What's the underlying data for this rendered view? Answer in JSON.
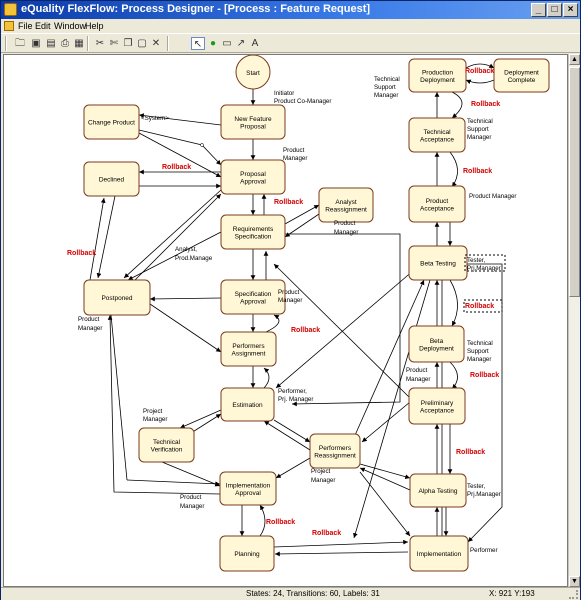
{
  "window": {
    "title": "eQuality FlexFlow: Process Designer - [Process : Feature Request]",
    "controls": [
      "_",
      "□",
      "×"
    ]
  },
  "menu": [
    "File",
    "Edit",
    "Window",
    "Help"
  ],
  "toolbar": {
    "icons": [
      "open-icon",
      "save-icon",
      "save-as-icon",
      "print-icon",
      "pdf-icon",
      "cut-icon",
      "scissors-icon",
      "copy-icon",
      "paste-icon",
      "delete-icon",
      "pointer-icon",
      "state-icon",
      "rect-icon",
      "arrow-icon",
      "label-icon"
    ]
  },
  "diagram": {
    "start_label": "Start",
    "states": [
      {
        "id": "change_product",
        "label": [
          "Change Product"
        ]
      },
      {
        "id": "new_feature",
        "label": [
          "New Feature",
          "Proposal"
        ]
      },
      {
        "id": "declined",
        "label": [
          "Declined"
        ]
      },
      {
        "id": "proposal_approval",
        "label": [
          "Proposal",
          "Approval"
        ]
      },
      {
        "id": "analyst_reassign",
        "label": [
          "Analyst",
          "Reassignment"
        ]
      },
      {
        "id": "req_spec",
        "label": [
          "Requirements",
          "Specification"
        ]
      },
      {
        "id": "postponed",
        "label": [
          "Postponed"
        ]
      },
      {
        "id": "spec_approval",
        "label": [
          "Specification",
          "Approval"
        ]
      },
      {
        "id": "perf_assign",
        "label": [
          "Performers",
          "Assignment"
        ]
      },
      {
        "id": "estimation",
        "label": [
          "Estimation"
        ]
      },
      {
        "id": "tech_verif",
        "label": [
          "Technical",
          "Verification"
        ]
      },
      {
        "id": "impl_approval",
        "label": [
          "Implementation",
          "Approval"
        ]
      },
      {
        "id": "planning",
        "label": [
          "Planning"
        ]
      },
      {
        "id": "prod_deploy",
        "label": [
          "Production",
          "Deployment"
        ]
      },
      {
        "id": "deploy_complete",
        "label": [
          "Deployment",
          "Complete"
        ]
      },
      {
        "id": "tech_accept",
        "label": [
          "Technical",
          "Acceptance"
        ]
      },
      {
        "id": "product_accept",
        "label": [
          "Product",
          "Acceptance"
        ]
      },
      {
        "id": "beta_testing",
        "label": [
          "Beta Testing"
        ]
      },
      {
        "id": "beta_deploy",
        "label": [
          "Beta",
          "Deployment"
        ]
      },
      {
        "id": "prelim_accept",
        "label": [
          "Preliminary",
          "Acceptance"
        ]
      },
      {
        "id": "perf_reassign",
        "label": [
          "Performers",
          "Reassignment"
        ]
      },
      {
        "id": "alpha_testing",
        "label": [
          "Alpha Testing"
        ]
      },
      {
        "id": "implementation",
        "label": [
          "Implementation"
        ]
      }
    ],
    "labels": {
      "initiator": [
        "Initiator",
        "Product Co-Manager"
      ],
      "system": "<System>",
      "pm_proposal": [
        "Product",
        "Manager"
      ],
      "pm_analyst": [
        "Product",
        "Manager"
      ],
      "analyst_prod": [
        "Analyst,",
        "Prod.Manage"
      ],
      "pm_spec": [
        "Product",
        "Manager"
      ],
      "pm_postponed": [
        "Product",
        "Manager"
      ],
      "performer_pm": [
        "Performer,",
        "Prj. Manager"
      ],
      "project_manager_tv": [
        "Project",
        "Manager"
      ],
      "project_manager_pr": [
        "Project",
        "Manager"
      ],
      "pm_impl": [
        "Product",
        "Manager"
      ],
      "tsm_prod": [
        "Technical",
        "Support",
        "Manager"
      ],
      "tsm_tech": [
        "Technical",
        "Support",
        "Manager"
      ],
      "pm_product_accept": "Product Manager",
      "tester_beta": [
        "Tester,",
        "Prj.Manager"
      ],
      "tsm_beta": [
        "Technical",
        "Support",
        "Manager"
      ],
      "pm_prelim": [
        "Product",
        "Manager"
      ],
      "tester_alpha": [
        "Tester,",
        "Prj.Manager"
      ],
      "performer": "Performer"
    },
    "rollback": "Rollback"
  },
  "status": {
    "summary": "States: 24, Transitions: 60, Labels: 31",
    "coords": "X: 921   Y:193"
  }
}
